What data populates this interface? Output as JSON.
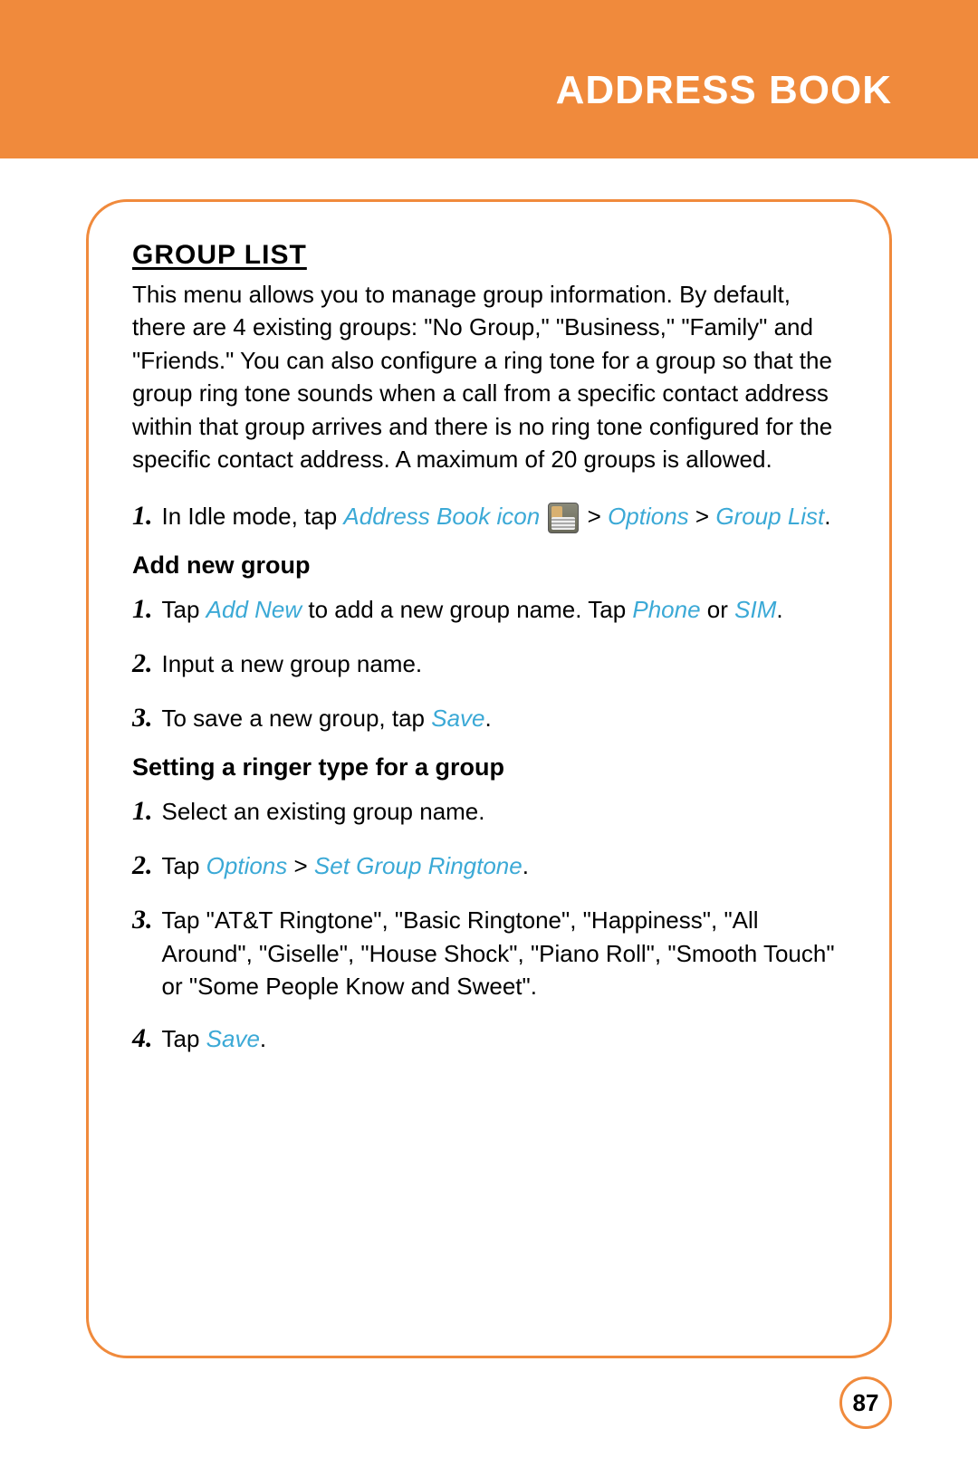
{
  "header": {
    "title": "ADDRESS BOOK"
  },
  "section": {
    "title": "GROUP LIST",
    "intro": "This menu allows you to manage group information. By default, there are 4 existing groups: \"No Group,\" \"Business,\" \"Family\" and \"Friends.\" You can also configure a ring tone for a group so that the group ring tone sounds when a call from a specific contact address within that group arrives and there is no ring tone configured for the specific contact address. A maximum of 20 groups is allowed."
  },
  "step_main": {
    "num": "1.",
    "prefix": "In Idle mode, tap ",
    "link1": "Address Book icon",
    "mid1": " ",
    "iconName": "address-book-icon",
    "mid2": " > ",
    "link2": "Options",
    "mid3": " > ",
    "link3": "Group List",
    "suffix": "."
  },
  "sub1": {
    "heading": "Add new group",
    "steps": [
      {
        "num": "1.",
        "parts": [
          {
            "t": "Tap ",
            "link": false
          },
          {
            "t": "Add New",
            "link": true
          },
          {
            "t": " to add a new group name. Tap ",
            "link": false
          },
          {
            "t": "Phone",
            "link": true
          },
          {
            "t": " or ",
            "link": false
          },
          {
            "t": "SIM",
            "link": true
          },
          {
            "t": ".",
            "link": false
          }
        ]
      },
      {
        "num": "2.",
        "parts": [
          {
            "t": "Input a new group name.",
            "link": false
          }
        ]
      },
      {
        "num": "3.",
        "parts": [
          {
            "t": "To save a new group, tap ",
            "link": false
          },
          {
            "t": "Save",
            "link": true
          },
          {
            "t": ".",
            "link": false
          }
        ]
      }
    ]
  },
  "sub2": {
    "heading": "Setting a ringer type for a group",
    "steps": [
      {
        "num": "1.",
        "parts": [
          {
            "t": "Select an existing group name.",
            "link": false
          }
        ]
      },
      {
        "num": "2.",
        "parts": [
          {
            "t": "Tap ",
            "link": false
          },
          {
            "t": "Options",
            "link": true
          },
          {
            "t": " > ",
            "link": false
          },
          {
            "t": "Set Group Ringtone",
            "link": true
          },
          {
            "t": ".",
            "link": false
          }
        ]
      },
      {
        "num": "3.",
        "parts": [
          {
            "t": "Tap \"AT&T Ringtone\", \"Basic Ringtone\", \"Happiness\", \"All Around\", \"Giselle\", \"House Shock\", \"Piano Roll\", \"Smooth Touch\" or \"Some People Know and Sweet\".",
            "link": false
          }
        ]
      },
      {
        "num": "4.",
        "parts": [
          {
            "t": "Tap ",
            "link": false
          },
          {
            "t": "Save",
            "link": true
          },
          {
            "t": ".",
            "link": false
          }
        ]
      }
    ]
  },
  "pageNumber": "87"
}
